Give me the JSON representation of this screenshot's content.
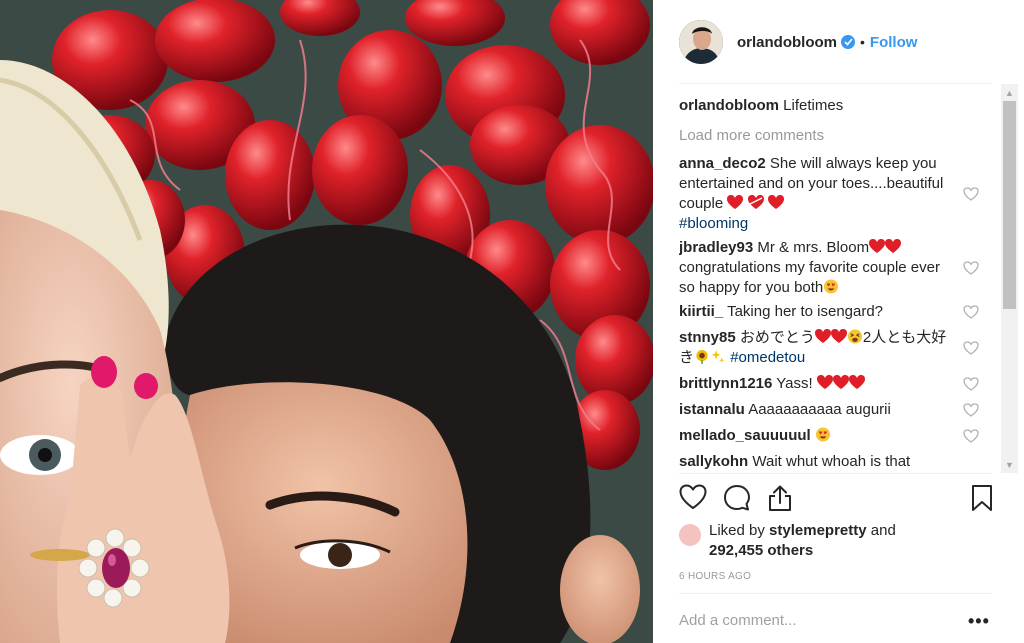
{
  "post": {
    "photo_alt": "",
    "header": {
      "username": "orlandobloom",
      "separator": "•",
      "follow_label": "Follow"
    },
    "caption": {
      "username": "orlandobloom",
      "text": "Lifetimes"
    },
    "load_more_label": "Load more comments",
    "comments": [
      {
        "user": "anna_deco2",
        "text": "She will always keep you entertained and on your toes....beautiful couple",
        "emoji": [
          "red-heart",
          "heart-ribbon",
          "red-heart"
        ],
        "tag": "#blooming"
      },
      {
        "user": "jbradley93",
        "text": "Mr & mrs. Bloom",
        "emoji": [
          "red-heart",
          "red-heart"
        ],
        "text2": "congratulations my favorite couple ever so happy for you both",
        "emoji2": [
          "heart-eyes-face"
        ]
      },
      {
        "user": "kiirtii_",
        "text": "Taking her to isengard?"
      },
      {
        "user": "stnny85",
        "text": "おめでとう",
        "emoji": [
          "red-heart",
          "red-heart",
          "squinting-face"
        ],
        "text2": "2人とも大好き",
        "emoji2": [
          "sunflower",
          "sparkles"
        ],
        "tag": "#omedetou"
      },
      {
        "user": "brittlynn1216",
        "text": "Yass!",
        "emoji": [
          "red-heart",
          "red-heart",
          "red-heart"
        ]
      },
      {
        "user": "istannalu",
        "text": "Aaaaaaaaaaa augurii"
      },
      {
        "user": "mellado_sauuuuul",
        "text": "",
        "emoji": [
          "heart-eyes-face"
        ]
      },
      {
        "user": "sallykohn",
        "text": "Wait whut whoah is that"
      }
    ],
    "likes": {
      "prefix": "Liked by",
      "user": "stylemepretty",
      "and": "and",
      "count": "292,455 others"
    },
    "timestamp": "6 HOURS AGO",
    "add_comment_placeholder": "Add a comment...",
    "more_options": "•••"
  },
  "icons": {
    "like": "heart-outline-icon",
    "comment": "speech-bubble-icon",
    "share": "share-upload-icon",
    "save": "bookmark-icon",
    "verified": "verified-badge-icon"
  },
  "colors": {
    "link_blue": "#3897f0",
    "hashtag": "#003569",
    "muted": "#999999",
    "text": "#262626",
    "heart_red": "#e0245e"
  }
}
